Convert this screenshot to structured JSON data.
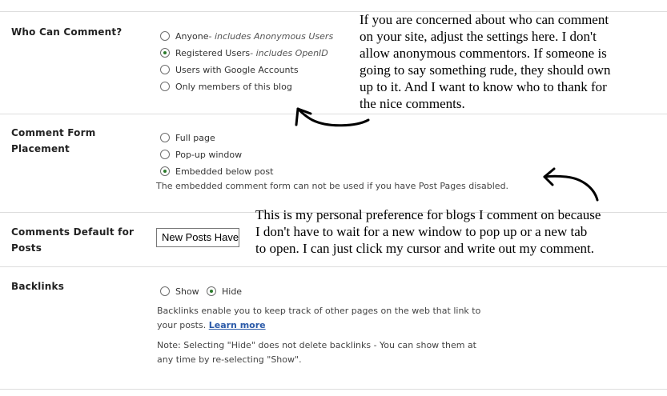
{
  "who_can_comment": {
    "label": "Who Can Comment?",
    "options": [
      {
        "label": "Anyone",
        "hint": " - includes Anonymous Users",
        "selected": false
      },
      {
        "label": "Registered Users",
        "hint": " - includes OpenID",
        "selected": true
      },
      {
        "label": "Users with Google Accounts",
        "hint": "",
        "selected": false
      },
      {
        "label": "Only members of this blog",
        "hint": "",
        "selected": false
      }
    ]
  },
  "comment_form_placement": {
    "label_line1": "Comment Form",
    "label_line2": "Placement",
    "options": [
      {
        "label": "Full page",
        "selected": false
      },
      {
        "label": "Pop-up window",
        "selected": false
      },
      {
        "label": "Embedded below post",
        "selected": true
      }
    ],
    "help": "The embedded comment form can not be used if you have Post Pages disabled."
  },
  "comments_default": {
    "label_line1": "Comments Default for",
    "label_line2": "Posts",
    "select_value": "New Posts Have Comments"
  },
  "backlinks": {
    "label": "Backlinks",
    "options": [
      {
        "label": "Show",
        "selected": false
      },
      {
        "label": "Hide",
        "selected": true
      }
    ],
    "help_line1": "Backlinks enable you to keep track of other pages on the web that link to",
    "help_line2_prefix": "your posts. ",
    "learn_more": "Learn more",
    "note_line1": "Note: Selecting \"Hide\" does not delete backlinks - You can show them at",
    "note_line2": "any time by re-selecting \"Show\"."
  },
  "annotations": {
    "top": [
      "If you are concerned about who can comment",
      "on your site, adjust the settings here.  I don't",
      "allow anonymous commentors.  If someone is",
      "going to say something rude, they should own",
      "up to it.  And I want to know who to thank for",
      "the nice comments."
    ],
    "middle": [
      "This is my personal preference for blogs I comment on because",
      "I don't have to wait for a new window to pop up or a new tab",
      "to open.  I can just click my cursor and write out my comment."
    ]
  },
  "colors": {
    "radio_selected": "#2a7a2a",
    "link": "#2b5aa8",
    "divider": "#dddddd"
  }
}
